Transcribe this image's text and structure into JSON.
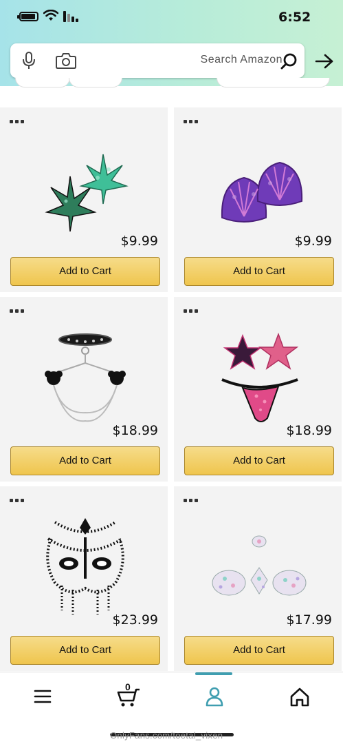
{
  "status": {
    "time": "6:52"
  },
  "search": {
    "placeholder": "Search Amazon"
  },
  "products": [
    {
      "price": "$9.99",
      "button": "Add to Cart",
      "icon": "seashell-pasties-image"
    },
    {
      "price": "$9.99",
      "button": "Add to Cart",
      "icon": "leaf-pasties-image"
    },
    {
      "price": "$18.99",
      "button": "Add to Cart",
      "icon": "star-pasties-set-image"
    },
    {
      "price": "$18.99",
      "button": "Add to Cart",
      "icon": "choker-chain-pasties-image"
    },
    {
      "price": "$17.99",
      "button": "Add to Cart",
      "icon": "jewel-body-gems-image"
    },
    {
      "price": "$23.99",
      "button": "Add to Cart",
      "icon": "rhinestone-mask-image"
    }
  ],
  "bottom_nav": {
    "cart_count": "0",
    "items": [
      "home-icon",
      "account-icon",
      "cart-icon",
      "menu-icon"
    ],
    "active": "account-icon"
  },
  "watermark": "OnlyFans.com/toetal_vixen",
  "colors": {
    "accent": "#3f9eb0",
    "button": "#efc54d"
  }
}
